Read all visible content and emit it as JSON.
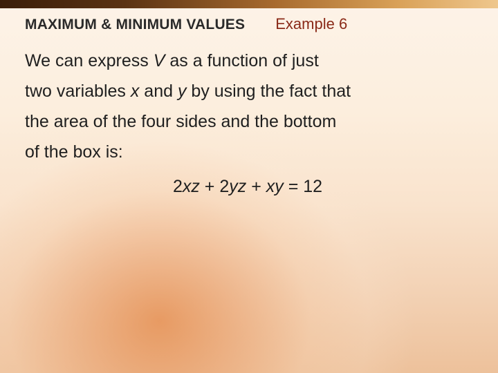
{
  "header": {
    "section_title": "MAXIMUM & MINIMUM VALUES",
    "example_label": "Example 6"
  },
  "body": {
    "line1_a": "We can express ",
    "line1_V": "V",
    "line1_b": " as a function of just",
    "line2_a": "two variables ",
    "line2_x": "x",
    "line2_b": " and ",
    "line2_y": "y",
    "line2_c": " by using the fact that",
    "line3": "the area of the four sides and the bottom",
    "line4": "of the box is:"
  },
  "equation": {
    "t1": "2",
    "xz": "xz",
    "t2": " + 2",
    "yz": "yz",
    "t3": " + ",
    "xy": "xy",
    "t4": " = 12"
  }
}
